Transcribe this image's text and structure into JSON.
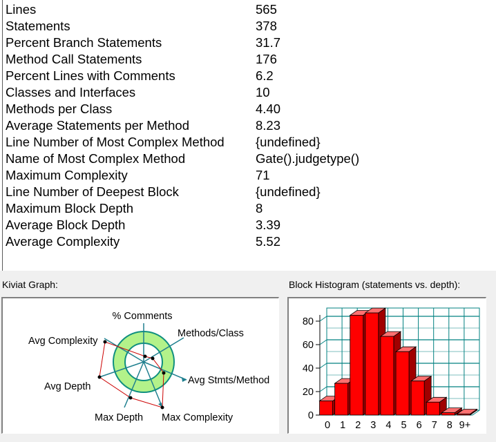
{
  "metrics": [
    {
      "name": "Lines",
      "value": "565"
    },
    {
      "name": "Statements",
      "value": "378"
    },
    {
      "name": "Percent Branch Statements",
      "value": "31.7"
    },
    {
      "name": "Method Call Statements",
      "value": "176"
    },
    {
      "name": "Percent Lines with Comments",
      "value": "6.2"
    },
    {
      "name": "Classes and Interfaces",
      "value": "10"
    },
    {
      "name": "Methods per Class",
      "value": "4.40"
    },
    {
      "name": "Average Statements per Method",
      "value": "8.23"
    },
    {
      "name": "Line Number of Most Complex Method",
      "value": "{undefined}"
    },
    {
      "name": "Name of Most Complex Method",
      "value": "Gate().judgetype()"
    },
    {
      "name": "Maximum Complexity",
      "value": "71"
    },
    {
      "name": "Line Number of Deepest Block",
      "value": "{undefined}"
    },
    {
      "name": "Maximum Block Depth",
      "value": "8"
    },
    {
      "name": "Average Block Depth",
      "value": "3.39"
    },
    {
      "name": "Average Complexity",
      "value": "5.52"
    }
  ],
  "kiviat": {
    "label": "Kiviat Graph:",
    "axes": [
      "% Comments",
      "Methods/Class",
      "Avg Stmts/Method",
      "Max Complexity",
      "Max Depth",
      "Avg Depth",
      "Avg Complexity"
    ]
  },
  "histogram": {
    "label": "Block Histogram (statements vs. depth):"
  },
  "colors": {
    "ring_fill": "#b3f28a",
    "ring_stroke": "#0f8f7f",
    "spoke": "#1f7f8f",
    "polygon": "#cc0000",
    "bar_front": "#ff0000",
    "bar_side": "#a00000",
    "bar_top": "#ff7070",
    "grid": "#008080"
  },
  "chart_data": {
    "type": "bar",
    "categories": [
      "0",
      "1",
      "2",
      "3",
      "4",
      "5",
      "6",
      "7",
      "8",
      "9+"
    ],
    "values": [
      12,
      27,
      85,
      87,
      67,
      54,
      29,
      11,
      2,
      0
    ],
    "ylim": [
      0,
      90
    ],
    "yticks": [
      "0",
      "20",
      "40",
      "60",
      "80"
    ],
    "grid": true
  }
}
